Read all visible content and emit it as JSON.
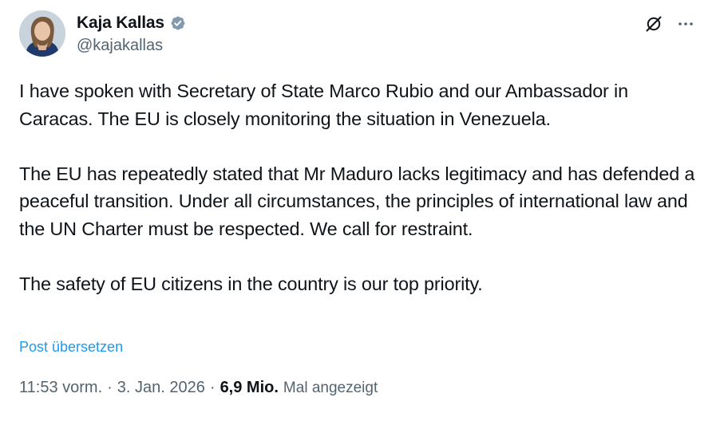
{
  "author": {
    "display_name": "Kaja Kallas",
    "handle": "@kajakallas",
    "verified_icon": "verified-badge-icon",
    "verified_color": "#829aab"
  },
  "actions": {
    "grok_icon": "grok-icon",
    "more_icon": "more-horizontal-icon"
  },
  "tweet": {
    "paragraphs": [
      "I have spoken with Secretary of State Marco Rubio and our Ambassador in Caracas. The EU is closely monitoring the situation in Venezuela.",
      "The EU has repeatedly stated that Mr Maduro lacks legitimacy and has defended a peaceful transition. Under all circumstances, the principles of international law and the UN Charter must be respected. We call for restraint.",
      "The safety of EU citizens in the country is our top priority."
    ],
    "translate_label": "Post übersetzen"
  },
  "meta": {
    "time": "11:53 vorm.",
    "date": "3. Jan. 2026",
    "separator": "·",
    "views_count": "6,9 Mio.",
    "views_label": "Mal angezeigt"
  },
  "colors": {
    "link": "#1d9bf0",
    "text": "#0f1419",
    "secondary": "#536471"
  }
}
